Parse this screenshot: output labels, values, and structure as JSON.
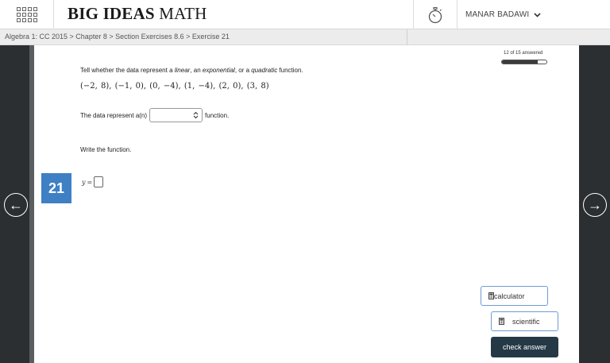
{
  "header": {
    "logo_bold": "BIG IDEAS",
    "logo_regular": "MATH",
    "user_name": "MANAR BADAWI",
    "user_chevron": "∨"
  },
  "breadcrumb": {
    "text": "Algebra 1: CC 2015 > Chapter 8 > Section Exercises 8.6 > Exercise 21"
  },
  "progress": {
    "text": "12 of 15 answered",
    "answered": 12,
    "total": 15
  },
  "question": {
    "prompt_start": "Tell whether the data represent a ",
    "option_linear": "linear",
    "prompt_mid1": ", an ",
    "option_exponential": "exponential",
    "prompt_mid2": ", or a ",
    "option_quadratic": "quadratic",
    "prompt_end": " function.",
    "points": "(−2, 8),  (−1, 0),  (0, −4),  (1, −4),  (2, 0),  (3, 8)",
    "sentence_start": "The data represent a(n)",
    "sentence_end": "function.",
    "select_value": "",
    "write_prompt": "Write the function.",
    "number": "21",
    "answer_label": "y",
    "answer_equals": "=",
    "answer_value": ""
  },
  "tools": {
    "calculator_label": "calculator",
    "scientific_label": "scientific",
    "check_label": "check answer"
  },
  "nav": {
    "prev_glyph": "←",
    "next_glyph": "→"
  },
  "colors": {
    "badge": "#3f7fc4",
    "check_button": "#253846",
    "side_panel": "#2b2f31",
    "tool_border": "#6f9bd1"
  }
}
